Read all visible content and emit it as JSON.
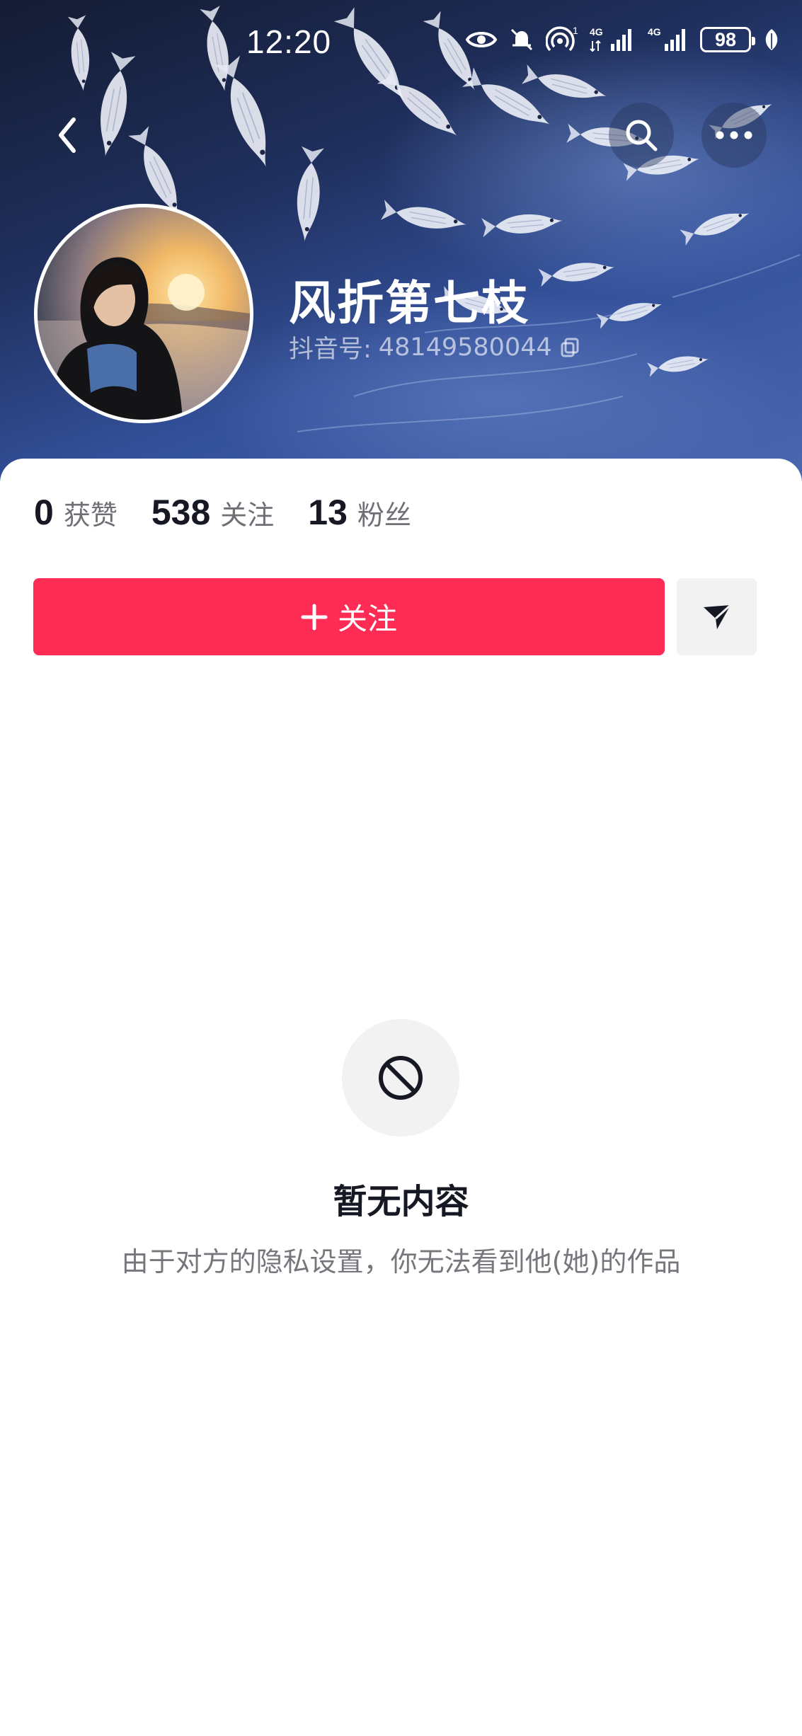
{
  "status_bar": {
    "time": "12:20",
    "battery": "98",
    "network_1": "4G",
    "network_2": "4G",
    "sim_index": "1",
    "icons": [
      "eye-icon",
      "mute-bell-icon",
      "hotspot-icon",
      "signal-4g-icon",
      "signal-4g-icon",
      "battery-icon",
      "leaf-icon"
    ]
  },
  "nav": {
    "icons": [
      "chevron-left-icon",
      "search-icon",
      "more-icon"
    ]
  },
  "profile": {
    "name": "风折第七枝",
    "douyin_id_label": "抖音号:",
    "douyin_id": "48149580044",
    "banner_theme": "white fish on blue water",
    "avatar_theme": "girl at sunset beach"
  },
  "stats": [
    {
      "value": "0",
      "label": "获赞"
    },
    {
      "value": "538",
      "label": "关注"
    },
    {
      "value": "13",
      "label": "粉丝"
    }
  ],
  "actions": {
    "follow_label": "关注",
    "follow_color": "#fe2c55",
    "message_icon": "send-icon"
  },
  "empty_state": {
    "icon": "forbidden-icon",
    "title": "暂无内容",
    "subtitle": "由于对方的隐私设置，你无法看到他(她)的作品"
  }
}
